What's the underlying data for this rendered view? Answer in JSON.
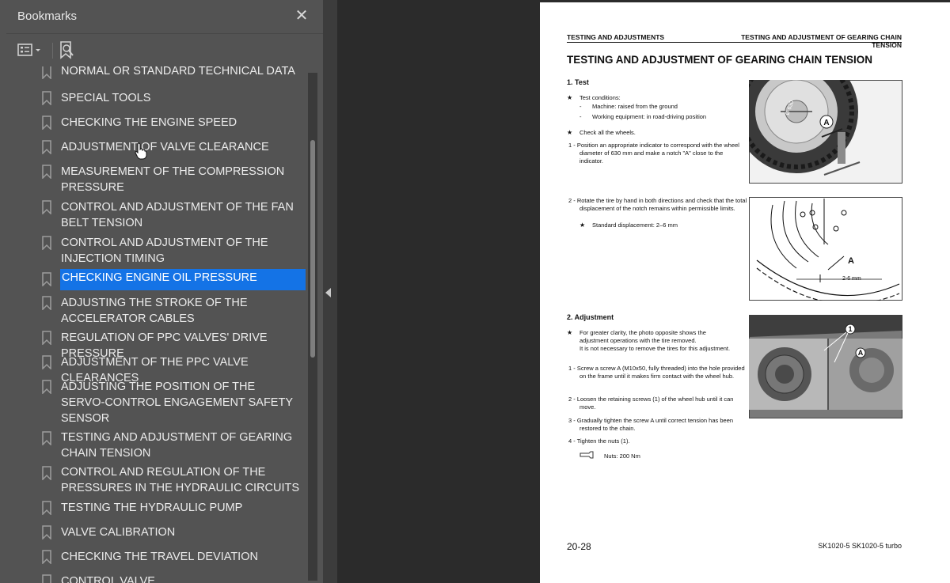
{
  "bookmarks_panel": {
    "title": "Bookmarks",
    "close_icon": "close-icon",
    "toolbar": {
      "options_icon": "bookmark-options-icon",
      "find_icon": "find-bookmark-icon"
    },
    "items": [
      {
        "label": "NORMAL OR STANDARD TECHNICAL DATA",
        "selected": false
      },
      {
        "label": "SPECIAL TOOLS",
        "selected": false
      },
      {
        "label": "CHECKING THE ENGINE SPEED",
        "selected": false
      },
      {
        "label": "ADJUSTMENT OF VALVE CLEARANCE",
        "selected": false
      },
      {
        "label": "MEASUREMENT OF THE COMPRESSION PRESSURE",
        "selected": false
      },
      {
        "label": "CONTROL AND ADJUSTMENT OF THE FAN BELT TENSION",
        "selected": false
      },
      {
        "label": "CONTROL AND ADJUSTMENT OF THE INJECTION TIMING",
        "selected": false
      },
      {
        "label": "CHECKING ENGINE OIL PRESSURE",
        "selected": true
      },
      {
        "label": "ADJUSTING THE STROKE OF THE ACCELERATOR CABLES",
        "selected": false
      },
      {
        "label": "REGULATION OF PPC VALVES' DRIVE PRESSURE",
        "selected": false
      },
      {
        "label": "ADJUSTMENT OF THE PPC VALVE CLEARANCES",
        "selected": false
      },
      {
        "label": "ADJUSTING THE POSITION OF THE SERVO-CONTROL ENGAGEMENT SAFETY SENSOR",
        "selected": false
      },
      {
        "label": "TESTING AND ADJUSTMENT OF GEARING CHAIN TENSION",
        "selected": false
      },
      {
        "label": "CONTROL AND REGULATION OF THE PRESSURES IN THE HYDRAULIC CIRCUITS",
        "selected": false
      },
      {
        "label": "TESTING THE HYDRAULIC PUMP",
        "selected": false
      },
      {
        "label": "VALVE CALIBRATION",
        "selected": false
      },
      {
        "label": "CHECKING THE TRAVEL DEVIATION",
        "selected": false
      },
      {
        "label": "CONTROL VALVE",
        "selected": false
      }
    ]
  },
  "document": {
    "header_left": "TESTING AND ADJUSTMENTS",
    "header_right": "TESTING AND ADJUSTMENT OF GEARING CHAIN TENSION",
    "title": "TESTING AND ADJUSTMENT OF GEARING CHAIN TENSION",
    "section1": {
      "heading": "1.   Test",
      "star1": "Test conditions:",
      "bullet1": "Machine: raised from the ground",
      "bullet2": "Working equipment: in road-driving position",
      "star2": "Check all the wheels.",
      "step1": "1 - Position an appropriate indicator to correspond with the wheel diameter of 630 mm and make a notch \"A\" close to the indicator.",
      "step2": "2 - Rotate the tire by hand in both directions and check that the total displacement of the notch remains within permissible limits.",
      "standard": "Standard displacement: 2–6 mm"
    },
    "section2": {
      "heading": "2.   Adjustment",
      "star1": "For greater clarity, the photo opposite shows the adjustment operations with the tire removed.",
      "star1b": "It is not necessary to remove the tires for this adjustment.",
      "step1": "1 - Screw a screw A (M10x50, fully threaded) into the hole provided on the frame until it makes firm contact with the wheel hub.",
      "step2": "2 - Loosen the retaining screws (1) of the wheel hub until it can move.",
      "step3": "3 - Gradually tighten the screw A until correct tension has been restored to the chain.",
      "step4": "4 - Tighten the nuts (1).",
      "torque": "Nuts: 200 Nm"
    },
    "figure1_labels": {
      "a": "A",
      "diam": "Ø 630"
    },
    "figure2_labels": {
      "a": "A",
      "dim": "2-6 mm"
    },
    "figure3_labels": {
      "one": "1",
      "a": "A"
    },
    "page_number": "20-28",
    "footer_right": "SK1020-5  SK1020-5 turbo"
  },
  "colors": {
    "panel_bg": "#535353",
    "selection": "#1473e6",
    "viewer_bg": "#2b2b2b"
  }
}
